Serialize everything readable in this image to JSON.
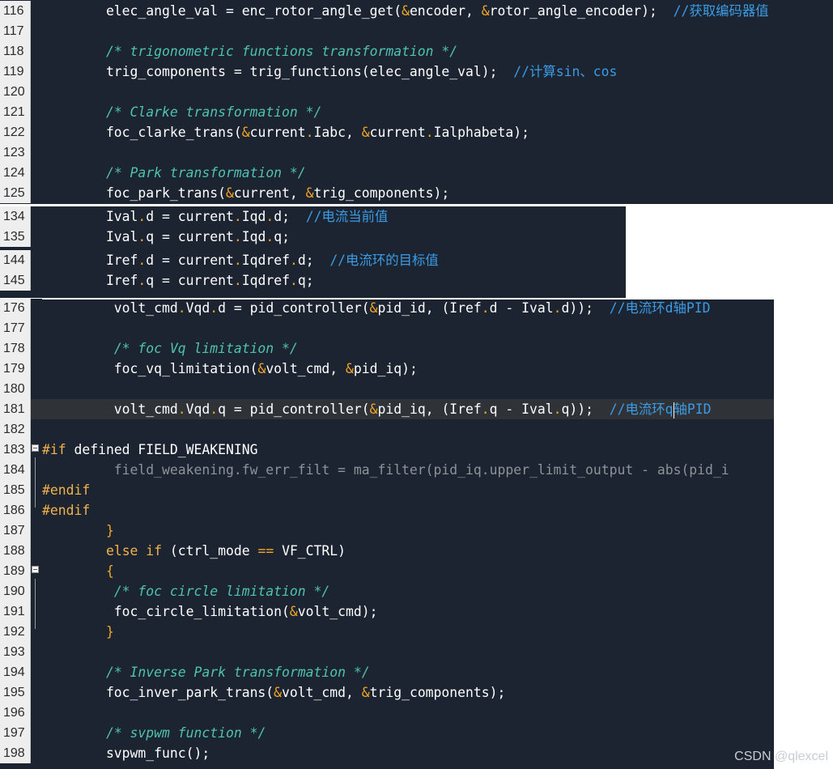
{
  "watermark": "CSDN @qlexcel",
  "panel1": {
    "lines": [
      {
        "n": "116",
        "parts": [
          [
            "        elec_angle_val = enc_rotor_angle_get(",
            ""
          ],
          [
            "&",
            "op"
          ],
          [
            "encoder, ",
            ""
          ],
          [
            "&",
            "op"
          ],
          [
            "rotor_angle_encoder);  ",
            ""
          ],
          [
            "//获取编码器值",
            "cm"
          ]
        ]
      },
      {
        "n": "117",
        "parts": []
      },
      {
        "n": "118",
        "parts": [
          [
            "        ",
            ""
          ],
          [
            "/* trigonometric functions transformation */",
            "cmp"
          ]
        ]
      },
      {
        "n": "119",
        "parts": [
          [
            "        trig_components = trig_functions(elec_angle_val);  ",
            ""
          ],
          [
            "//计算sin、cos",
            "cm"
          ]
        ]
      },
      {
        "n": "120",
        "parts": []
      },
      {
        "n": "121",
        "parts": [
          [
            "        ",
            ""
          ],
          [
            "/* Clarke transformation */",
            "cmp"
          ]
        ]
      },
      {
        "n": "122",
        "parts": [
          [
            "        foc_clarke_trans(",
            ""
          ],
          [
            "&",
            "op"
          ],
          [
            "current",
            ""
          ],
          [
            ".",
            "op"
          ],
          [
            "Iabc, ",
            ""
          ],
          [
            "&",
            "op"
          ],
          [
            "current",
            ""
          ],
          [
            ".",
            "op"
          ],
          [
            "Ialphabeta);",
            ""
          ]
        ]
      },
      {
        "n": "123",
        "parts": []
      },
      {
        "n": "124",
        "parts": [
          [
            "        ",
            ""
          ],
          [
            "/* Park transformation */",
            "cmp"
          ]
        ]
      },
      {
        "n": "125",
        "parts": [
          [
            "        foc_park_trans(",
            ""
          ],
          [
            "&",
            "op"
          ],
          [
            "current, ",
            ""
          ],
          [
            "&",
            "op"
          ],
          [
            "trig_components);",
            ""
          ]
        ]
      }
    ]
  },
  "panel2": {
    "lines": [
      {
        "n": "134",
        "parts": [
          [
            "        Ival",
            ""
          ],
          [
            ".",
            "op"
          ],
          [
            "d = current",
            ""
          ],
          [
            ".",
            "op"
          ],
          [
            "Iqd",
            ""
          ],
          [
            ".",
            "op"
          ],
          [
            "d;  ",
            ""
          ],
          [
            "//电流当前值",
            "cm"
          ]
        ]
      },
      {
        "n": "135",
        "parts": [
          [
            "        Ival",
            ""
          ],
          [
            ".",
            "op"
          ],
          [
            "q = current",
            ""
          ],
          [
            ".",
            "op"
          ],
          [
            "Iqd",
            ""
          ],
          [
            ".",
            "op"
          ],
          [
            "q;",
            ""
          ]
        ]
      },
      {
        "n": "144",
        "parts": [
          [
            "        Iref",
            ""
          ],
          [
            ".",
            "op"
          ],
          [
            "d = current",
            ""
          ],
          [
            ".",
            "op"
          ],
          [
            "Iqdref",
            ""
          ],
          [
            ".",
            "op"
          ],
          [
            "d;  ",
            ""
          ],
          [
            "//电流环的目标值",
            "cm"
          ]
        ]
      },
      {
        "n": "145",
        "parts": [
          [
            "        Iref",
            ""
          ],
          [
            ".",
            "op"
          ],
          [
            "q = current",
            ""
          ],
          [
            ".",
            "op"
          ],
          [
            "Iqdref",
            ""
          ],
          [
            ".",
            "op"
          ],
          [
            "q;",
            ""
          ]
        ]
      }
    ]
  },
  "panel3": {
    "lines": [
      {
        "n": "176",
        "parts": [
          [
            "         volt_cmd",
            ""
          ],
          [
            ".",
            "op"
          ],
          [
            "Vqd",
            ""
          ],
          [
            ".",
            "op"
          ],
          [
            "d = pid_controller(",
            ""
          ],
          [
            "&",
            "op"
          ],
          [
            "pid_id, (Iref",
            ""
          ],
          [
            ".",
            "op"
          ],
          [
            "d - Ival",
            ""
          ],
          [
            ".",
            "op"
          ],
          [
            "d));  ",
            ""
          ],
          [
            "//电流环d轴PID",
            "cm"
          ]
        ]
      },
      {
        "n": "177",
        "parts": []
      },
      {
        "n": "178",
        "parts": [
          [
            "         ",
            ""
          ],
          [
            "/* foc Vq limitation */",
            "cmp"
          ]
        ]
      },
      {
        "n": "179",
        "parts": [
          [
            "         foc_vq_limitation(",
            ""
          ],
          [
            "&",
            "op"
          ],
          [
            "volt_cmd, ",
            ""
          ],
          [
            "&",
            "op"
          ],
          [
            "pid_iq);",
            ""
          ]
        ]
      },
      {
        "n": "180",
        "parts": []
      },
      {
        "n": "181",
        "cursor": true,
        "parts": [
          [
            "         volt_cmd",
            ""
          ],
          [
            ".",
            "op"
          ],
          [
            "Vqd",
            ""
          ],
          [
            ".",
            "op"
          ],
          [
            "q = pid_controller(",
            ""
          ],
          [
            "&",
            "op"
          ],
          [
            "pid_iq, (Iref",
            ""
          ],
          [
            ".",
            "op"
          ],
          [
            "q - Ival",
            ""
          ],
          [
            ".",
            "op"
          ],
          [
            "q));  ",
            ""
          ],
          [
            "//电流环q",
            "cm"
          ],
          [
            "|",
            "caret"
          ],
          [
            "轴PID",
            "cm"
          ]
        ]
      },
      {
        "n": "182",
        "parts": []
      },
      {
        "n": "183",
        "fold": true,
        "parts": [
          [
            "#if",
            "pp"
          ],
          [
            " defined FIELD_WEAKENING",
            ""
          ]
        ]
      },
      {
        "n": "184",
        "parts": [
          [
            "         field_weakening.fw_err_filt = ma_filter(pid_iq.upper_limit_output - abs(pid_i",
            "dim"
          ]
        ]
      },
      {
        "n": "185",
        "parts": [
          [
            "#endif",
            "pp"
          ]
        ]
      },
      {
        "n": "186",
        "parts": [
          [
            "#endif",
            "pp"
          ]
        ]
      },
      {
        "n": "187",
        "parts": [
          [
            "        ",
            ""
          ],
          [
            "}",
            "op"
          ]
        ]
      },
      {
        "n": "188",
        "parts": [
          [
            "        ",
            ""
          ],
          [
            "else if",
            "kw"
          ],
          [
            " (ctrl_mode ",
            ""
          ],
          [
            "==",
            "op"
          ],
          [
            " VF_CTRL)",
            ""
          ]
        ]
      },
      {
        "n": "189",
        "fold": true,
        "parts": [
          [
            "        ",
            ""
          ],
          [
            "{",
            "op"
          ]
        ]
      },
      {
        "n": "190",
        "parts": [
          [
            "         ",
            ""
          ],
          [
            "/* foc circle limitation */",
            "cmp"
          ]
        ]
      },
      {
        "n": "191",
        "parts": [
          [
            "         foc_circle_limitation(",
            ""
          ],
          [
            "&",
            "op"
          ],
          [
            "volt_cmd);",
            ""
          ]
        ]
      },
      {
        "n": "192",
        "parts": [
          [
            "        ",
            ""
          ],
          [
            "}",
            "op"
          ]
        ]
      },
      {
        "n": "193",
        "parts": []
      },
      {
        "n": "194",
        "parts": [
          [
            "        ",
            ""
          ],
          [
            "/* Inverse Park transformation */",
            "cmp"
          ]
        ]
      },
      {
        "n": "195",
        "parts": [
          [
            "        foc_inver_park_trans(",
            ""
          ],
          [
            "&",
            "op"
          ],
          [
            "volt_cmd, ",
            ""
          ],
          [
            "&",
            "op"
          ],
          [
            "trig_components);",
            ""
          ]
        ]
      },
      {
        "n": "196",
        "parts": []
      },
      {
        "n": "197",
        "parts": [
          [
            "        ",
            ""
          ],
          [
            "/* svpwm function */",
            "cmp"
          ]
        ]
      },
      {
        "n": "198",
        "parts": [
          [
            "        svpwm_func();",
            ""
          ]
        ]
      }
    ]
  }
}
